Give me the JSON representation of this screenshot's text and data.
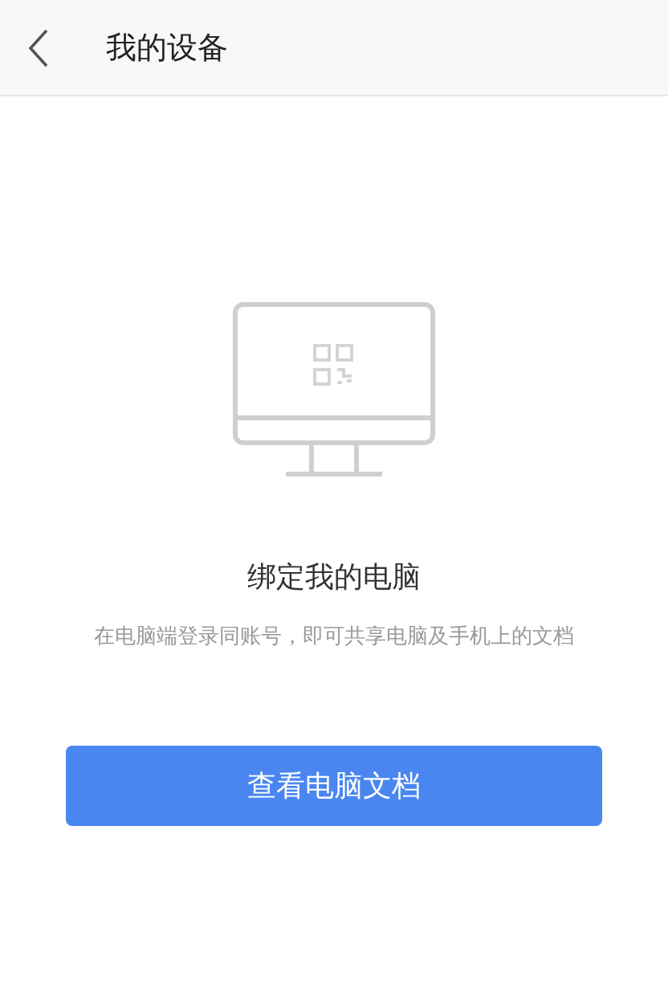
{
  "header": {
    "title": "我的设备"
  },
  "card": {
    "title": "绑定我的电脑",
    "description": "在电脑端登录同账号，即可共享电脑及手机上的文档"
  },
  "button": {
    "label": "查看电脑文档"
  }
}
